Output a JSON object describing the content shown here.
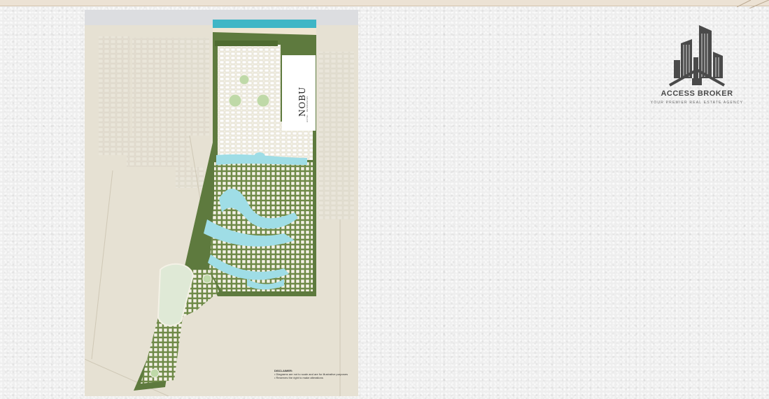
{
  "map": {
    "label_brand": "NOBU",
    "label_subtitle": "HOTEL · RESIDENCES",
    "disclaimer_title": "DISCLAIMER:",
    "disclaimer_lines": [
      "• Diagrams are not to scale and are for illustrative purposes",
      "• Reserves the right to make alterations"
    ],
    "colors": {
      "sea": "#3fb6c6",
      "lagoon": "#9fdde6",
      "greenery": "#5e7a3e",
      "sand": "#e7e2d5",
      "plots": "#f3efe4"
    }
  },
  "logo": {
    "name": "ACCESS BROKER",
    "tagline": "YOUR PREMIER REAL ESTATE AGENCY",
    "icon": "city-skyline-icon"
  }
}
